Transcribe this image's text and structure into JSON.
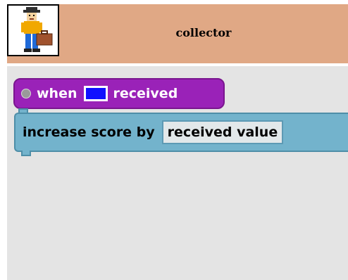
{
  "header": {
    "title": "collector",
    "background_color": "#e0a885",
    "avatar_icon": "person-with-briefcase-icon"
  },
  "hat_block": {
    "when_label": "when",
    "received_label": "received",
    "swatch_color": "#1010ff",
    "block_color": "#9a22b8"
  },
  "command_block": {
    "label": "increase score by",
    "value_label": "received value",
    "block_color": "#73b3cc"
  },
  "workspace": {
    "background_color": "#e4e4e4"
  }
}
